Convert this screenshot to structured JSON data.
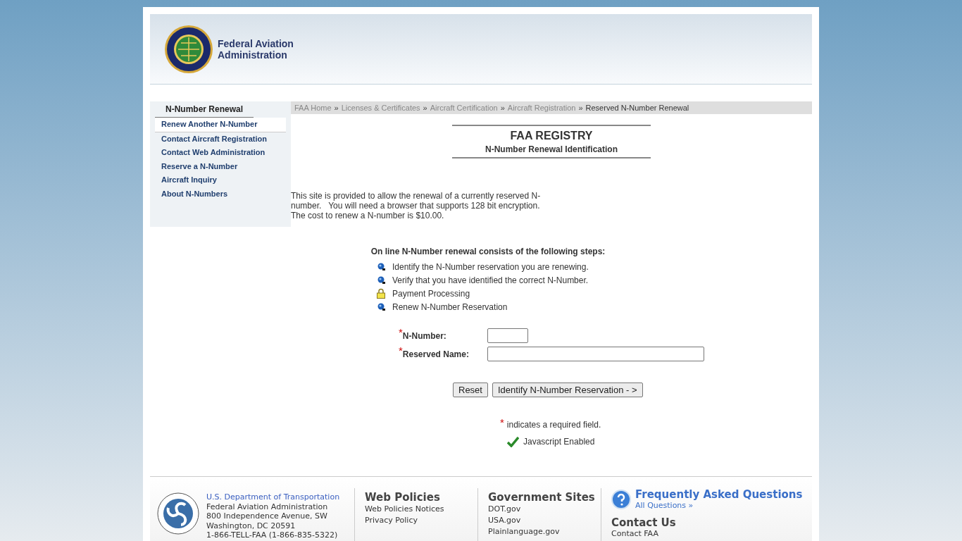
{
  "header": {
    "agency_name": "Federal Aviation Administration"
  },
  "sidebar": {
    "title": "N-Number Renewal",
    "items": [
      {
        "label": "Renew Another N-Number",
        "selected": true
      },
      {
        "label": "Contact Aircraft Registration",
        "selected": false
      },
      {
        "label": "Contact Web Administration",
        "selected": false
      },
      {
        "label": "Reserve a N-Number",
        "selected": false
      },
      {
        "label": "Aircraft Inquiry",
        "selected": false
      },
      {
        "label": "About N-Numbers",
        "selected": false
      }
    ]
  },
  "breadcrumb": {
    "links": [
      "FAA Home",
      "Licenses & Certificates",
      "Aircraft Certification",
      "Aircraft Registration"
    ],
    "separator": "»",
    "current": "Reserved N-Number Renewal"
  },
  "title": {
    "heading": "FAA REGISTRY",
    "subheading": "N-Number Renewal Identification"
  },
  "intro": [
    "This site is provided to allow the renewal of a currently reserved N-number.   You will need a browser that supports 128 bit encryption.",
    "The cost to renew a N-number is $10.00."
  ],
  "steps": {
    "heading": "On line N-Number renewal consists of the following steps:",
    "items": [
      {
        "kind": "bullet",
        "text": "Identify the N-Number reservation you are renewing."
      },
      {
        "kind": "bullet",
        "text": "Verify that you have identified the correct N-Number."
      },
      {
        "kind": "lock",
        "text": "Payment Processing"
      },
      {
        "kind": "bullet",
        "text": "Renew N-Number Reservation"
      }
    ]
  },
  "form": {
    "required_mark": "*",
    "fields": [
      {
        "label": "N-Number:",
        "kind": "short"
      },
      {
        "label": "Reserved Name:",
        "kind": "long"
      }
    ],
    "buttons": [
      "Reset",
      "Identify N-Number Reservation - >"
    ],
    "required_note": "indicates a required field.",
    "js_status": "Javascript Enabled"
  },
  "footer": {
    "dot_link": "U.S. Department of Transportation",
    "address": [
      "Federal Aviation Administration",
      "800 Independence Avenue, SW",
      "Washington, DC 20591",
      "1-866-TELL-FAA (1-866-835-5322)"
    ],
    "columns": [
      {
        "heading": "Web Policies",
        "links": [
          "Web Policies Notices",
          "Privacy Policy"
        ]
      },
      {
        "heading": "Government Sites",
        "links": [
          "DOT.gov",
          "USA.gov",
          "Plainlanguage.gov"
        ]
      }
    ],
    "faq": {
      "heading": "Frequently Asked Questions",
      "link": "All Questions »"
    },
    "contact": {
      "heading": "Contact Us",
      "links": [
        "Contact FAA"
      ]
    }
  }
}
